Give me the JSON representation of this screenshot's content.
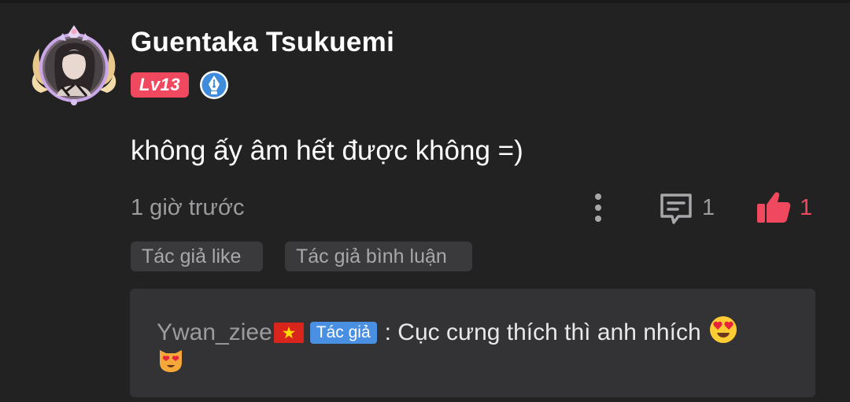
{
  "comment": {
    "username": "Guentaka Tsukuemi",
    "level": "Lv13",
    "text": "không ấy âm hết được không =)",
    "timestamp": "1 giờ trước",
    "reply_count": "1",
    "like_count": "1"
  },
  "tags": {
    "author_liked": "Tác giả like",
    "author_commented": "Tác giả bình luận"
  },
  "reply": {
    "username": "Ywan_ziee",
    "author_badge": "Tác giả",
    "text": ": Cục cưng thích thì anh nhích"
  },
  "icons": {
    "more": "more-vertical-icon",
    "comment": "comment-icon",
    "like": "thumbs-up-icon",
    "pen_badge": "pen-nib-badge-icon",
    "flag": "vietnam-flag-icon",
    "emoji_1": "heart-eyes-face-emoji",
    "emoji_2": "heart-eyes-cat-emoji"
  },
  "colors": {
    "background": "#222223",
    "accent_pink": "#f0485f",
    "muted_text": "#9c9c9e",
    "tag_bg": "#3a3a3c",
    "reply_bg": "#333335",
    "author_badge_bg": "#4a90e2"
  }
}
